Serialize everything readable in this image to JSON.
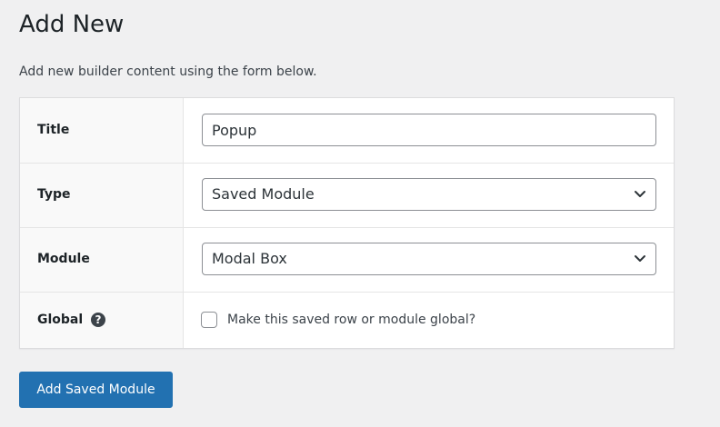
{
  "page": {
    "title": "Add New",
    "description": "Add new builder content using the form below."
  },
  "form": {
    "title_row": {
      "label": "Title",
      "value": "Popup"
    },
    "type_row": {
      "label": "Type",
      "selected": "Saved Module",
      "icon": "chevron-down-icon"
    },
    "module_row": {
      "label": "Module",
      "selected": "Modal Box",
      "icon": "chevron-down-icon"
    },
    "global_row": {
      "label": "Global",
      "help_icon": "?",
      "checkbox_label": "Make this saved row or module global?",
      "checked": false
    },
    "submit_label": "Add Saved Module"
  },
  "colors": {
    "background": "#f0f0f1",
    "accent": "#2271b1",
    "text": "#1d2327",
    "border": "#8c8f94"
  }
}
